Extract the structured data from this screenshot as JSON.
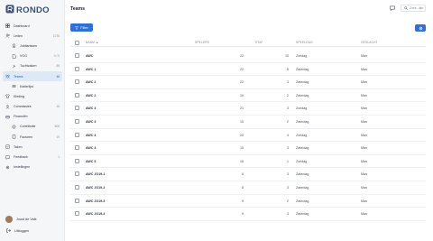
{
  "app": {
    "logo_text": "RONDO"
  },
  "sidebar": {
    "items": [
      {
        "label": "Dashboard",
        "count": "",
        "sub": false,
        "active": false,
        "icon": "dashboard-icon"
      },
      {
        "label": "Leden",
        "count": "1276",
        "sub": false,
        "active": false,
        "icon": "users-icon"
      },
      {
        "label": "Jubilarissen",
        "count": "",
        "sub": true,
        "active": false,
        "icon": "award-icon"
      },
      {
        "label": "VOG",
        "count": "0 / 9",
        "sub": true,
        "active": false,
        "icon": "document-icon"
      },
      {
        "label": "Tuchtzaken",
        "count": "88",
        "sub": true,
        "active": false,
        "icon": "gavel-icon"
      },
      {
        "label": "Teams",
        "count": "46",
        "sub": false,
        "active": true,
        "icon": "team-icon"
      },
      {
        "label": "Kaderlijst",
        "count": "",
        "sub": true,
        "active": false,
        "icon": "list-icon"
      },
      {
        "label": "Kleding",
        "count": "",
        "sub": false,
        "active": false,
        "icon": "shirt-icon"
      },
      {
        "label": "Commissies",
        "count": "16",
        "sub": false,
        "active": false,
        "icon": "group-icon"
      },
      {
        "label": "Financiën",
        "count": "",
        "sub": false,
        "active": false,
        "icon": "finance-icon"
      },
      {
        "label": "Contributie",
        "count": "806",
        "sub": true,
        "active": false,
        "icon": "coins-icon"
      },
      {
        "label": "Facturen",
        "count": "19",
        "sub": true,
        "active": false,
        "icon": "invoice-icon"
      },
      {
        "label": "Taken",
        "count": "",
        "sub": false,
        "active": false,
        "icon": "checkbox-icon"
      },
      {
        "label": "Feedback",
        "count": "1",
        "sub": false,
        "active": false,
        "icon": "chat-icon"
      },
      {
        "label": "Instellingen",
        "count": "",
        "sub": false,
        "active": false,
        "icon": "gear-icon"
      }
    ],
    "user_name": "Joost de Valk",
    "logout_label": "Uitloggen"
  },
  "header": {
    "title": "Teams",
    "search_placeholder": "Zoek...",
    "search_shortcut": "⌘K"
  },
  "toolbar": {
    "filter_label": "Filter"
  },
  "table": {
    "columns": {
      "name": "NAAM ▲",
      "spelers": "SPELERS",
      "staf": "STAF",
      "speeldag": "SPEELDAG",
      "geslacht": "GESLACHT"
    },
    "rows": [
      {
        "name": "AWC",
        "spelers": "22",
        "staf": "10",
        "speeldag": "Zondag",
        "geslacht": "Man"
      },
      {
        "name": "AWC 1",
        "spelers": "22",
        "staf": "5",
        "speeldag": "Zaterdag",
        "geslacht": "Man"
      },
      {
        "name": "AWC 2",
        "spelers": "22",
        "staf": "3",
        "speeldag": "Zaterdag",
        "geslacht": "Man"
      },
      {
        "name": "AWC 2",
        "spelers": "19",
        "staf": "2",
        "speeldag": "Zaterdag",
        "geslacht": "Man"
      },
      {
        "name": "AWC 3",
        "spelers": "21",
        "staf": "3",
        "speeldag": "Zondag",
        "geslacht": "Man"
      },
      {
        "name": "AWC 3",
        "spelers": "15",
        "staf": "2",
        "speeldag": "Zaterdag",
        "geslacht": "Man"
      },
      {
        "name": "AWC 4",
        "spelers": "20",
        "staf": "4",
        "speeldag": "Zondag",
        "geslacht": "Man"
      },
      {
        "name": "AWC 4",
        "spelers": "15",
        "staf": "3",
        "speeldag": "Zaterdag",
        "geslacht": "Man"
      },
      {
        "name": "AWC 5",
        "spelers": "18",
        "staf": "1",
        "speeldag": "Zondag",
        "geslacht": "Man"
      },
      {
        "name": "AWC JO19-1",
        "spelers": "6",
        "staf": "3",
        "speeldag": "Zaterdag",
        "geslacht": "Man"
      },
      {
        "name": "AWC JO19-2",
        "spelers": "8",
        "staf": "3",
        "speeldag": "Zaterdag",
        "geslacht": "Man"
      },
      {
        "name": "AWC JO19-3",
        "spelers": "9",
        "staf": "2",
        "speeldag": "Zaterdag",
        "geslacht": "Man"
      },
      {
        "name": "AWC JO19-4",
        "spelers": "9",
        "staf": "3",
        "speeldag": "Zaterdag",
        "geslacht": "Man"
      }
    ]
  },
  "colors": {
    "accent": "#2f6fd6",
    "active_bg": "#dde9f7",
    "active_text": "#2563b8",
    "logo": "#3a5170"
  }
}
